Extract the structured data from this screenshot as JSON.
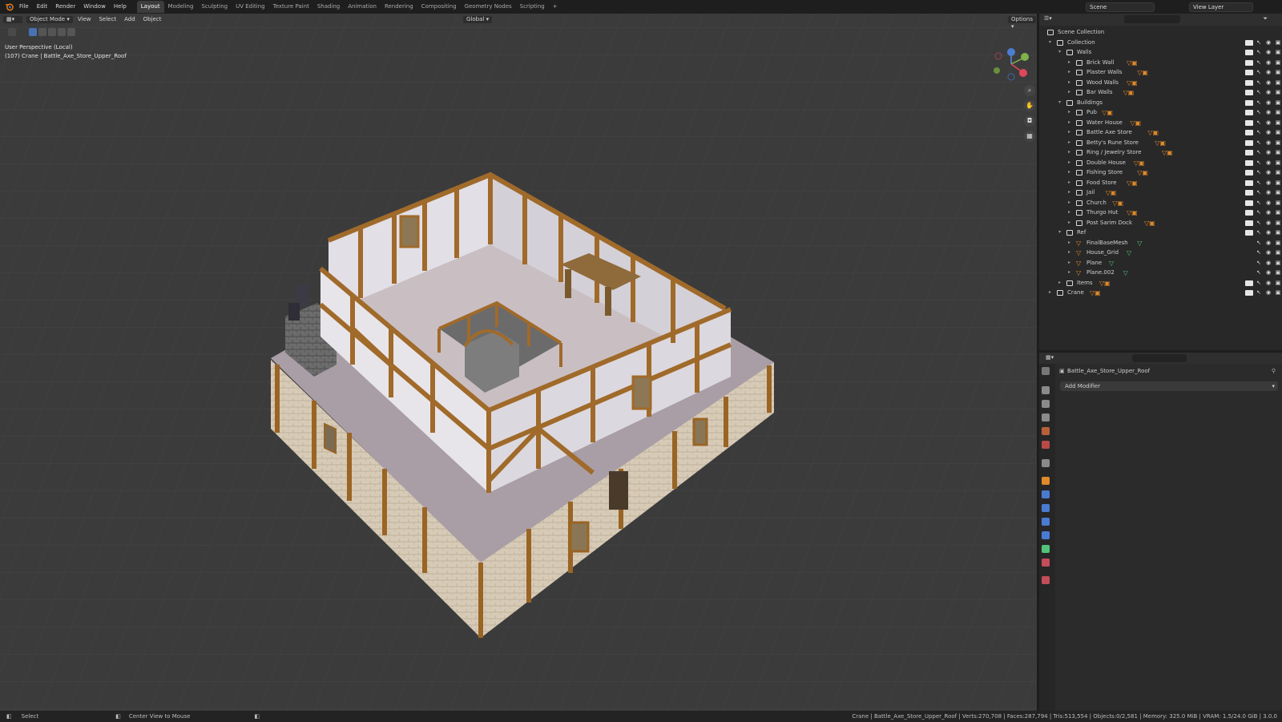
{
  "topbar": {
    "menus": [
      "File",
      "Edit",
      "Render",
      "Window",
      "Help"
    ],
    "workspaces": [
      "Layout",
      "Modeling",
      "Sculpting",
      "UV Editing",
      "Texture Paint",
      "Shading",
      "Animation",
      "Rendering",
      "Compositing",
      "Geometry Nodes",
      "Scripting",
      "+"
    ],
    "active_workspace": "Layout",
    "scene": "Scene",
    "view_layer": "View Layer"
  },
  "viewport": {
    "mode": "Object Mode",
    "menus": [
      "View",
      "Select",
      "Add",
      "Object"
    ],
    "transform": "Global",
    "options": "Options",
    "info_line1": "User Perspective (Local)",
    "info_line2": "(107) Crane | Battle_Axe_Store_Upper_Roof"
  },
  "outliner": {
    "rows": [
      {
        "label": "Scene Collection",
        "indent": 0,
        "kind": "scene",
        "tri": ""
      },
      {
        "label": "Collection",
        "indent": 1,
        "kind": "coll",
        "tri": "▾"
      },
      {
        "label": "Walls",
        "indent": 2,
        "kind": "coll",
        "tri": "▾"
      },
      {
        "label": "Brick Wall",
        "indent": 3,
        "kind": "coll",
        "tri": "▸",
        "m": "▽"
      },
      {
        "label": "Plaster Walls",
        "indent": 3,
        "kind": "coll",
        "tri": "▸",
        "m": "▽"
      },
      {
        "label": "Wood Walls",
        "indent": 3,
        "kind": "coll",
        "tri": "▸",
        "m": "▽"
      },
      {
        "label": "Bar Walls",
        "indent": 3,
        "kind": "coll",
        "tri": "▸",
        "m": "▽"
      },
      {
        "label": "Buildings",
        "indent": 2,
        "kind": "coll",
        "tri": "▾"
      },
      {
        "label": "Pub",
        "indent": 3,
        "kind": "coll",
        "tri": "▸",
        "m": "▽"
      },
      {
        "label": "Water House",
        "indent": 3,
        "kind": "coll",
        "tri": "▸",
        "m": "▽"
      },
      {
        "label": "Battle Axe Store",
        "indent": 3,
        "kind": "coll",
        "tri": "▸",
        "m": "▽"
      },
      {
        "label": "Betty's Rune Store",
        "indent": 3,
        "kind": "coll",
        "tri": "▸",
        "m": "▽"
      },
      {
        "label": "Ring / Jewelry Store",
        "indent": 3,
        "kind": "coll",
        "tri": "▸",
        "m": "▽"
      },
      {
        "label": "Double House",
        "indent": 3,
        "kind": "coll",
        "tri": "▸",
        "m": "▽"
      },
      {
        "label": "Fishing Store",
        "indent": 3,
        "kind": "coll",
        "tri": "▸",
        "m": "▽"
      },
      {
        "label": "Food Store",
        "indent": 3,
        "kind": "coll",
        "tri": "▸",
        "m": "▽"
      },
      {
        "label": "Jail",
        "indent": 3,
        "kind": "coll",
        "tri": "▸",
        "m": "▽"
      },
      {
        "label": "Church",
        "indent": 3,
        "kind": "coll",
        "tri": "▸",
        "m": "▽"
      },
      {
        "label": "Thurgo Hut",
        "indent": 3,
        "kind": "coll",
        "tri": "▸",
        "m": "▽"
      },
      {
        "label": "Post Sarim Dock",
        "indent": 3,
        "kind": "coll",
        "tri": "▸",
        "m": "▽"
      },
      {
        "label": "Ref",
        "indent": 2,
        "kind": "coll",
        "tri": "▾"
      },
      {
        "label": "FinalBaseMesh",
        "indent": 3,
        "kind": "obj",
        "tri": "▸",
        "g": "▽"
      },
      {
        "label": "House_Grid",
        "indent": 3,
        "kind": "obj",
        "tri": "▸",
        "g": "▽"
      },
      {
        "label": "Plane",
        "indent": 3,
        "kind": "obj",
        "tri": "▸",
        "g": "▽"
      },
      {
        "label": "Plane.002",
        "indent": 3,
        "kind": "obj",
        "tri": "▸",
        "g": "▽"
      },
      {
        "label": "Items",
        "indent": 2,
        "kind": "coll",
        "tri": "▸",
        "m": "▽"
      },
      {
        "label": "Crane",
        "indent": 1,
        "kind": "coll",
        "tri": "▸",
        "m": "▽"
      }
    ]
  },
  "properties": {
    "object_name": "Battle_Axe_Store_Upper_Roof",
    "add_modifier": "Add Modifier"
  },
  "statusbar": {
    "select": "Select",
    "center": "Center View to Mouse",
    "stats": "Crane | Battle_Axe_Store_Upper_Roof | Verts:270,708 | Faces:287,794 | Tris:513,554 | Objects:0/2,581 | Memory: 325.0 MiB | VRAM: 1.5/24.0 GiB | 3.0.0"
  },
  "colors": {
    "viewport_bg": "#3c3c3c",
    "timber": "#9a6424",
    "plaster": "#d9d6dc",
    "floor": "#a99ea6",
    "accent": "#4772b3"
  },
  "icons": [
    "blender-logo-icon",
    "search-icon",
    "filter-icon",
    "zoom-icon",
    "hand-icon",
    "camera-icon",
    "grid-icon",
    "wrench-icon",
    "eye-icon",
    "camera-render-icon",
    "checkbox-icon",
    "pin-icon"
  ]
}
